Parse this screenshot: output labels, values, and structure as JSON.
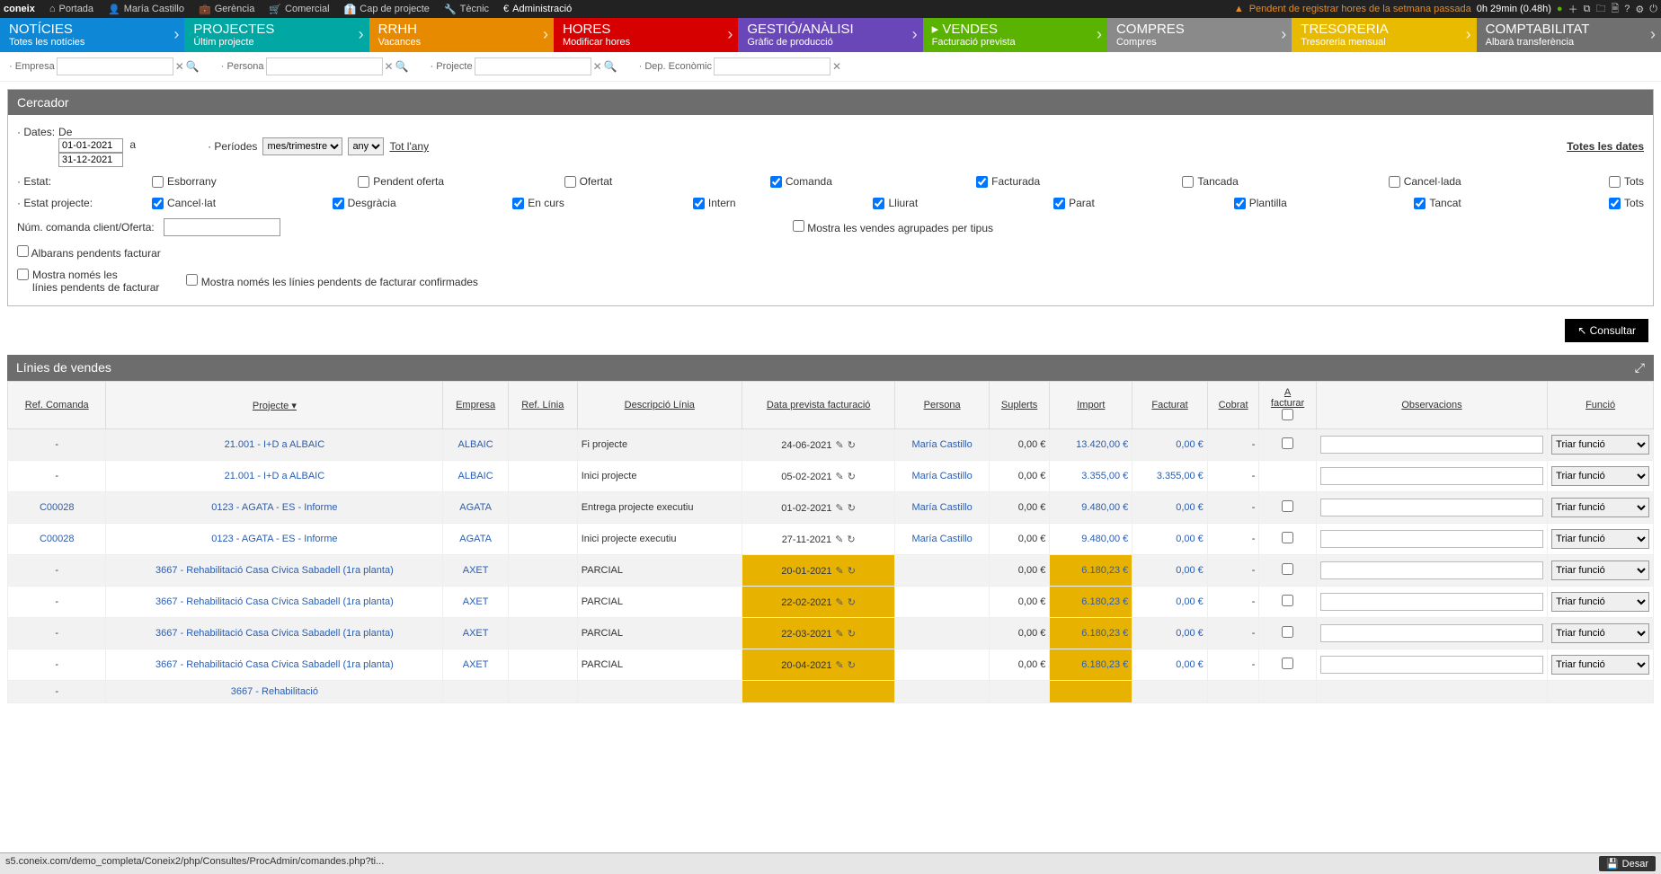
{
  "topbar": {
    "brand": "coneix",
    "items": [
      "Portada",
      "María Castillo",
      "Gerència",
      "Comercial",
      "Cap de projecte",
      "Tècnic",
      "Administració"
    ],
    "warn_text": "Pendent de registrar hores de la setmana passada",
    "time_text": "0h 29min (0.48h)"
  },
  "nav": [
    {
      "title": "NOTÍCIES",
      "sub": "Totes les notícies",
      "cls": "tab-noticies"
    },
    {
      "title": "PROJECTES",
      "sub": "Últim projecte",
      "cls": "tab-projectes"
    },
    {
      "title": "RRHH",
      "sub": "Vacances",
      "cls": "tab-rrhh"
    },
    {
      "title": "HORES",
      "sub": "Modificar hores",
      "cls": "tab-hores"
    },
    {
      "title": "GESTIÓ/ANÀLISI",
      "sub": "Gràfic de producció",
      "cls": "tab-gestio"
    },
    {
      "title": "VENDES",
      "sub": "Facturació prevista",
      "cls": "tab-vendes",
      "active": true
    },
    {
      "title": "COMPRES",
      "sub": "Compres",
      "cls": "tab-compres"
    },
    {
      "title": "TRESORERIA",
      "sub": "Tresoreria mensual",
      "cls": "tab-tresoreria"
    },
    {
      "title": "COMPTABILITAT",
      "sub": "Albarà transferència",
      "cls": "tab-comptabilitat"
    }
  ],
  "filters": {
    "empresa": "Empresa",
    "persona": "Persona",
    "projecte": "Projecte",
    "dep": "Dep. Econòmic"
  },
  "cercador": {
    "title": "Cercador",
    "dates_lbl": "Dates:",
    "de": "De",
    "a": "a",
    "date_from": "01-01-2021",
    "date_to": "31-12-2021",
    "periodes_lbl": "Períodes",
    "periode_sel": "mes/trimestre",
    "any_sel": "any",
    "tot_any": "Tot l'any",
    "totes_dates": "Totes les dates",
    "estat_lbl": "Estat:",
    "estat": [
      {
        "l": "Esborrany",
        "c": false
      },
      {
        "l": "Pendent oferta",
        "c": false
      },
      {
        "l": "Ofertat",
        "c": false
      },
      {
        "l": "Comanda",
        "c": true
      },
      {
        "l": "Facturada",
        "c": true
      },
      {
        "l": "Tancada",
        "c": false
      },
      {
        "l": "Cancel·lada",
        "c": false
      }
    ],
    "tots_estat": {
      "l": "Tots",
      "c": false
    },
    "estatproj_lbl": "Estat projecte:",
    "estatproj": [
      {
        "l": "Cancel·lat",
        "c": true
      },
      {
        "l": "Desgràcia",
        "c": true
      },
      {
        "l": "En curs",
        "c": true
      },
      {
        "l": "Intern",
        "c": true
      },
      {
        "l": "Lliurat",
        "c": true
      },
      {
        "l": "Parat",
        "c": true
      },
      {
        "l": "Plantilla",
        "c": true
      },
      {
        "l": "Tancat",
        "c": true
      }
    ],
    "tots_proj": {
      "l": "Tots",
      "c": true
    },
    "num_lbl": "Núm. comanda client/Oferta:",
    "mostra_agrup": "Mostra les vendes agrupades per tipus",
    "albarans": "Albarans pendents facturar",
    "mostra_nomes": "Mostra només les\nlínies pendents de facturar",
    "mostra_conf": "Mostra només les línies pendents de facturar confirmades",
    "consultar": "Consultar"
  },
  "grid": {
    "title": "Línies de vendes",
    "headers": [
      "Ref. Comanda",
      "Projecte",
      "Empresa",
      "Ref. Línia",
      "Descripció Línia",
      "Data prevista facturació",
      "Persona",
      "Suplerts",
      "Import",
      "Facturat",
      "Cobrat",
      "A facturar",
      "Observacions",
      "Funció"
    ],
    "func_opt": "Triar funció",
    "rows": [
      {
        "ref": "-",
        "proj": "21.001 - I+D a ALBAIC",
        "emp": "ALBAIC",
        "rl": "",
        "desc": "Fi projecte",
        "data": "24-06-2021",
        "hl": false,
        "persona": "María Castillo",
        "sup": "0,00 €",
        "imp": "13.420,00 €",
        "imphl": false,
        "fact": "0,00 €",
        "cob": "-",
        "chk": true,
        "even": true
      },
      {
        "ref": "-",
        "proj": "21.001 - I+D a ALBAIC",
        "emp": "ALBAIC",
        "rl": "",
        "desc": "Inici projecte",
        "data": "05-02-2021",
        "hl": false,
        "persona": "María Castillo",
        "sup": "0,00 €",
        "imp": "3.355,00 €",
        "imphl": false,
        "fact": "3.355,00 €",
        "cob": "-",
        "chk": false,
        "even": false
      },
      {
        "ref": "C00028",
        "proj": "0123 - AGATA - ES - Informe",
        "emp": "AGATA",
        "rl": "",
        "desc": "Entrega projecte executiu",
        "data": "01-02-2021",
        "hl": false,
        "persona": "María Castillo",
        "sup": "0,00 €",
        "imp": "9.480,00 €",
        "imphl": false,
        "fact": "0,00 €",
        "cob": "-",
        "chk": true,
        "even": true
      },
      {
        "ref": "C00028",
        "proj": "0123 - AGATA - ES - Informe",
        "emp": "AGATA",
        "rl": "",
        "desc": "Inici projecte executiu",
        "data": "27-11-2021",
        "hl": false,
        "persona": "María Castillo",
        "sup": "0,00 €",
        "imp": "9.480,00 €",
        "imphl": false,
        "fact": "0,00 €",
        "cob": "-",
        "chk": true,
        "even": false
      },
      {
        "ref": "-",
        "proj": "3667 - Rehabilitació Casa Cívica Sabadell (1ra planta)",
        "emp": "AXET",
        "rl": "",
        "desc": "PARCIAL",
        "data": "20-01-2021",
        "hl": true,
        "persona": "",
        "sup": "0,00 €",
        "imp": "6.180,23 €",
        "imphl": true,
        "fact": "0,00 €",
        "cob": "-",
        "chk": true,
        "even": true
      },
      {
        "ref": "-",
        "proj": "3667 - Rehabilitació Casa Cívica Sabadell (1ra planta)",
        "emp": "AXET",
        "rl": "",
        "desc": "PARCIAL",
        "data": "22-02-2021",
        "hl": true,
        "persona": "",
        "sup": "0,00 €",
        "imp": "6.180,23 €",
        "imphl": true,
        "fact": "0,00 €",
        "cob": "-",
        "chk": true,
        "even": false
      },
      {
        "ref": "-",
        "proj": "3667 - Rehabilitació Casa Cívica Sabadell (1ra planta)",
        "emp": "AXET",
        "rl": "",
        "desc": "PARCIAL",
        "data": "22-03-2021",
        "hl": true,
        "persona": "",
        "sup": "0,00 €",
        "imp": "6.180,23 €",
        "imphl": true,
        "fact": "0,00 €",
        "cob": "-",
        "chk": true,
        "even": true
      },
      {
        "ref": "-",
        "proj": "3667 - Rehabilitació Casa Cívica Sabadell (1ra planta)",
        "emp": "AXET",
        "rl": "",
        "desc": "PARCIAL",
        "data": "20-04-2021",
        "hl": true,
        "persona": "",
        "sup": "0,00 €",
        "imp": "6.180,23 €",
        "imphl": true,
        "fact": "0,00 €",
        "cob": "-",
        "chk": true,
        "even": false
      },
      {
        "ref": "-",
        "proj": "3667 - Rehabilitació",
        "emp": "",
        "rl": "",
        "desc": "",
        "data": "",
        "hl": true,
        "persona": "",
        "sup": "",
        "imp": "",
        "imphl": true,
        "fact": "",
        "cob": "",
        "chk": false,
        "even": true,
        "partial": true
      }
    ]
  },
  "status": {
    "url": "s5.coneix.com/demo_completa/Coneix2/php/Consultes/ProcAdmin/comandes.php?ti...",
    "desar": "Desar"
  }
}
